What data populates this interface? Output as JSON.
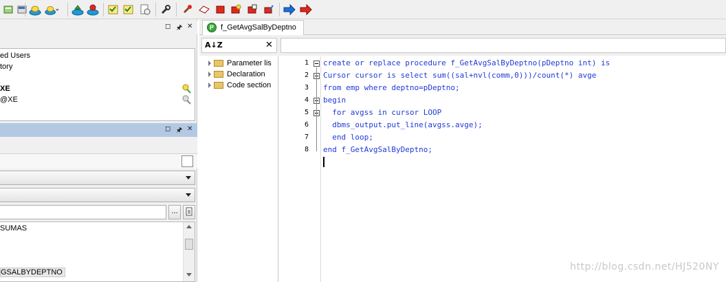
{
  "toolbar": {
    "icons": [
      "sql-window-icon",
      "command-window-icon",
      "execute-icon",
      "stop-icon",
      "commit-icon",
      "rollback-icon",
      "debug-icon",
      "compile-icon",
      "wrench-icon",
      "object-new-icon",
      "object-edit-icon",
      "object-delete-icon",
      "object-props-icon",
      "object-run-icon",
      "object-describe-icon",
      "back-icon",
      "forward-icon"
    ],
    "colors": {
      "back_arrow": "#1a6fd6",
      "forward_arrow": "#e0291b"
    }
  },
  "left_top_panel": {
    "items": [
      "ed Users",
      "tory",
      "XE",
      "@XE"
    ]
  },
  "left_bottom_panel": {
    "browse_button_label": "...",
    "list_items": [
      "SUMAS",
      "GSALBYDEPTNO"
    ]
  },
  "editor_tab": {
    "icon_letter": "P",
    "title": "f_GetAvgSalByDeptno"
  },
  "outline": {
    "sort_icon_label": "A↓Z",
    "close_label": "✕",
    "nodes": [
      "Parameter lis",
      "Declaration",
      "Code section"
    ]
  },
  "code": {
    "line_numbers": [
      "1",
      "2",
      "3",
      "4",
      "5",
      "6",
      "7",
      "8"
    ],
    "lines": [
      "create or replace procedure f_GetAvgSalByDeptno(pDeptno int) is",
      "Cursor cursor is select sum((sal+nvl(comm,0)))/count(*) avge",
      "from emp where deptno=pDeptno;",
      "begin",
      "  for avgss in cursor LOOP",
      "  dbms_output.put_line(avgss.avge);",
      "  end loop;",
      "end f_GetAvgSalByDeptno;"
    ],
    "color": "#1f3ad6"
  },
  "watermark": "http://blog.csdn.net/HJ520NY"
}
